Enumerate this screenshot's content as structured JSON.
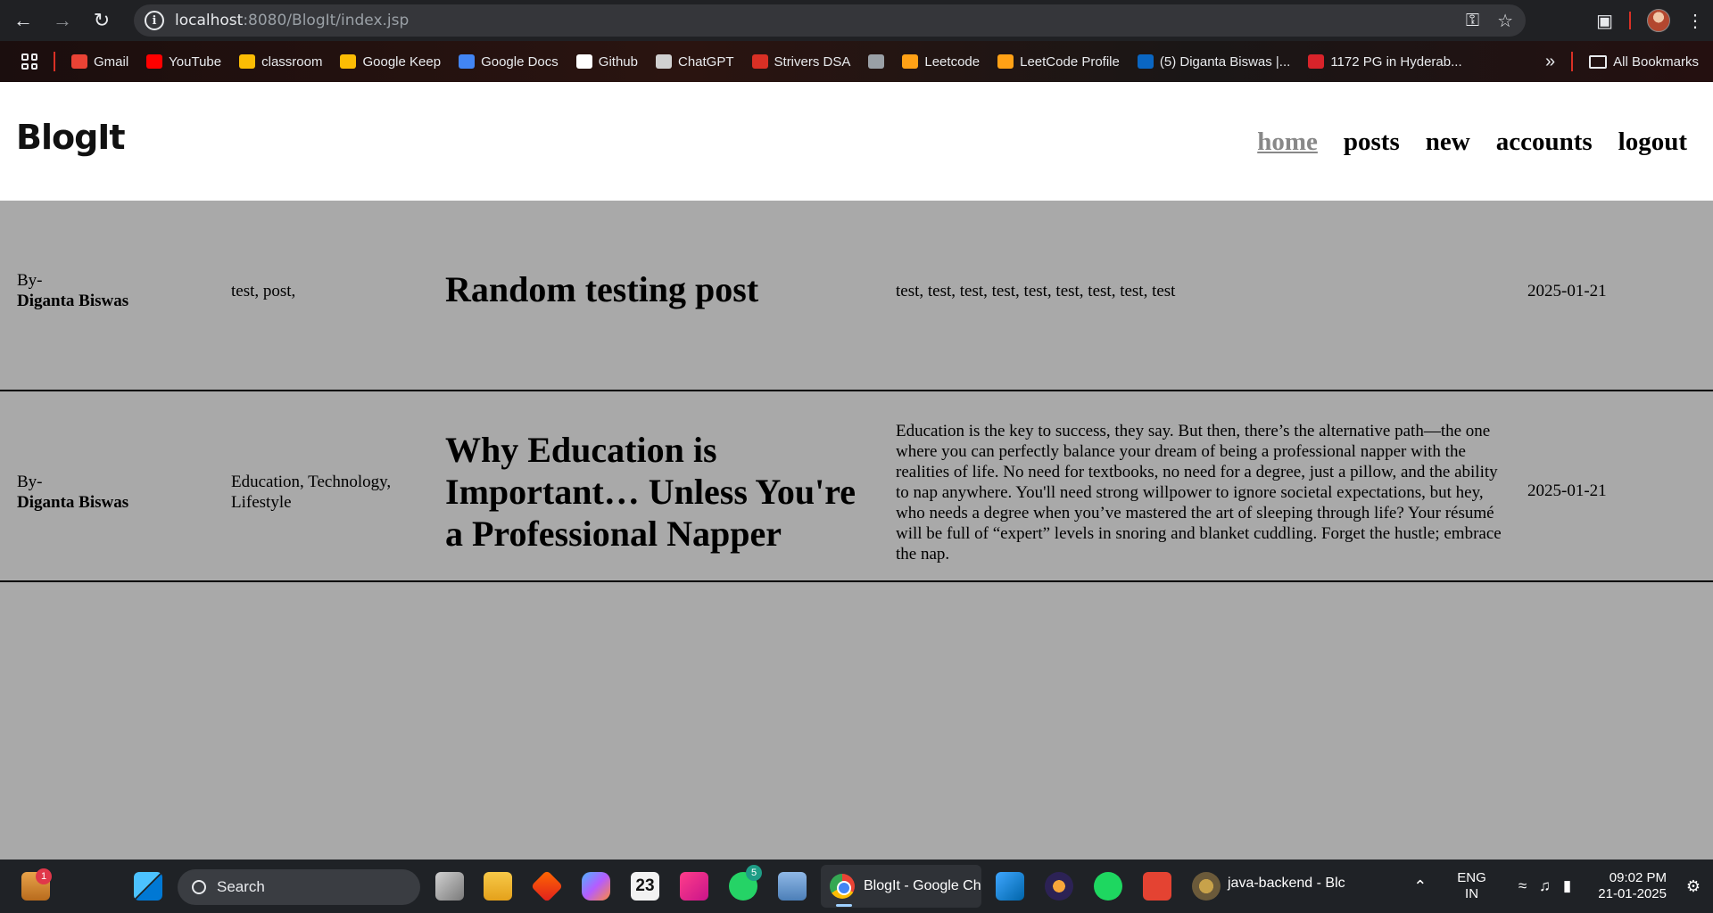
{
  "browser": {
    "url_host": "localhost",
    "url_path": ":8080/BlogIt/index.jsp",
    "bookmarks": [
      {
        "label": "Gmail",
        "icon": "gmail-icon",
        "color": "#ea4335"
      },
      {
        "label": "YouTube",
        "icon": "youtube-icon",
        "color": "#ff0000"
      },
      {
        "label": "classroom",
        "icon": "classroom-icon",
        "color": "#fbbc04"
      },
      {
        "label": "Google Keep",
        "icon": "keep-icon",
        "color": "#fbbc04"
      },
      {
        "label": "Google Docs",
        "icon": "docs-icon",
        "color": "#4285f4"
      },
      {
        "label": "Github",
        "icon": "github-icon",
        "color": "#ffffff"
      },
      {
        "label": "ChatGPT",
        "icon": "chatgpt-icon",
        "color": "#d0d0d0"
      },
      {
        "label": "Strivers DSA",
        "icon": "tuf-icon",
        "color": "#d93025"
      },
      {
        "label": "",
        "icon": "globe-icon",
        "color": "#9aa0a6"
      },
      {
        "label": "Leetcode",
        "icon": "leetcode-icon",
        "color": "#ffa116"
      },
      {
        "label": "LeetCode Profile",
        "icon": "leetcode-icon",
        "color": "#ffa116"
      },
      {
        "label": "(5) Diganta Biswas |...",
        "icon": "linkedin-icon",
        "color": "#0a66c2"
      },
      {
        "label": "1172 PG in Hyderab...",
        "icon": "magicbricks-icon",
        "color": "#d8232a"
      }
    ],
    "overflow_label": "»",
    "all_bookmarks_label": "All Bookmarks"
  },
  "site": {
    "logo": "BlogIt",
    "nav": [
      "home",
      "posts",
      "new",
      "accounts",
      "logout"
    ]
  },
  "posts": [
    {
      "by_label": "By-",
      "author": "Diganta Biswas",
      "tags": "test, post,",
      "title": "Random testing post",
      "body": "test, test, test, test, test, test, test, test, test",
      "date": "2025-01-21"
    },
    {
      "by_label": "By-",
      "author": "Diganta Biswas",
      "tags": "Education, Technology, Lifestyle",
      "title": "Why Education is Important… Unless You're a Professional Napper",
      "body": "Education is the key to success, they say. But then, there’s the alternative path—the one where you can perfectly balance your dream of being a professional napper with the realities of life. No need for textbooks, no need for a degree, just a pillow, and the ability to nap anywhere. You'll need strong willpower to ignore societal expectations, but hey, who needs a degree when you’ve mastered the art of sleeping through life? Your résumé will be full of “expert” levels in snoring and blanket cuddling. Forget the hustle; embrace the nap.",
      "date": "2025-01-21"
    }
  ],
  "taskbar": {
    "search_label": "Search",
    "weather_badge": "1",
    "whatsapp_badge": "5",
    "calendar_label": "23",
    "chrome_task": "BlogIt - Google Ch",
    "java_task": "java-backend - Blc",
    "lang_line1": "ENG",
    "lang_line2": "IN",
    "time": "09:02 PM",
    "date": "21-01-2025"
  },
  "colors": {
    "page_bg": "#a9a9a9",
    "header_bg": "#ffffff",
    "nav_active": "#888888"
  }
}
